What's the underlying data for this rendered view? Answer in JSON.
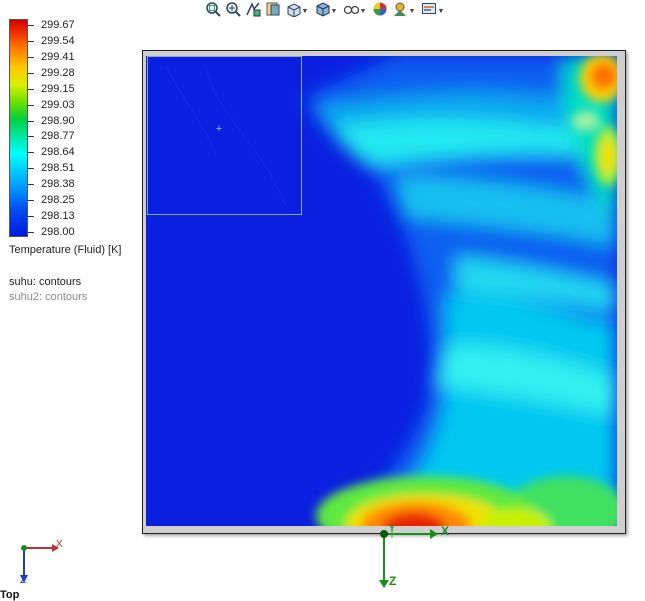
{
  "toolbar": {
    "buttons": [
      {
        "name": "zoom-to-fit-icon",
        "caret": false
      },
      {
        "name": "zoom-to-area-icon",
        "caret": false
      },
      {
        "name": "previous-view-icon",
        "caret": false
      },
      {
        "name": "section-view-icon",
        "caret": false
      },
      {
        "name": "view-orientation-icon",
        "caret": true
      },
      {
        "name": "display-style-icon",
        "caret": true
      },
      {
        "name": "hide-show-items-icon",
        "caret": true
      },
      {
        "name": "edit-appearance-icon",
        "caret": false
      },
      {
        "name": "apply-scene-icon",
        "caret": true
      },
      {
        "name": "view-settings-icon",
        "caret": true
      }
    ]
  },
  "legend": {
    "values": [
      "299.67",
      "299.54",
      "299.41",
      "299.28",
      "299.15",
      "299.03",
      "298.90",
      "298.77",
      "298.64",
      "298.51",
      "298.38",
      "298.25",
      "298.13",
      "298.00"
    ],
    "min": 298.0,
    "max": 299.67,
    "title": "Temperature (Fluid) [K]",
    "colors": [
      "#d40000",
      "#ff7a00",
      "#ffc800",
      "#6ee000",
      "#00d040",
      "#00ffff",
      "#0098ff",
      "#0018e0"
    ]
  },
  "plots": {
    "active": "suhu: contours",
    "inactive": "suhu2: contours"
  },
  "axes": {
    "x": "X",
    "y": "Y",
    "z": "Z",
    "view": "Top"
  }
}
